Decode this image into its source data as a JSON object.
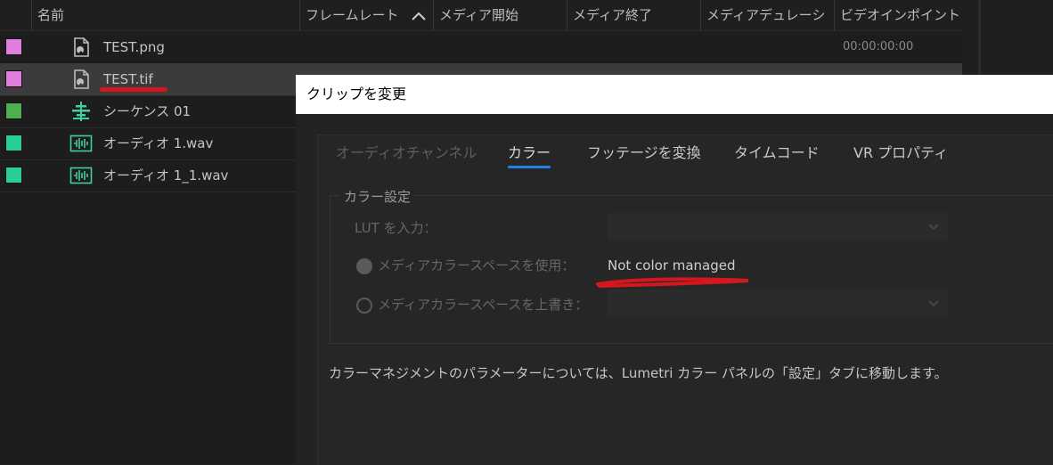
{
  "project_panel": {
    "columns": [
      "名前",
      "フレームレート",
      "メディア開始",
      "メディア終了",
      "メディアデュレーシ",
      "ビデオインポイント"
    ],
    "items": [
      {
        "name": "TEST.png",
        "color": "#e07ee0",
        "icon": "image-file-icon",
        "in_point": "00:00:00:00"
      },
      {
        "name": "TEST.tif",
        "color": "#e07ee0",
        "icon": "image-file-icon",
        "in_point": ""
      },
      {
        "name": "シーケンス 01",
        "color": "#4caf50",
        "icon": "sequence-icon",
        "in_point": ""
      },
      {
        "name": "オーディオ 1.wav",
        "color": "#27cf94",
        "icon": "audio-file-icon",
        "in_point": ""
      },
      {
        "name": "オーディオ 1_1.wav",
        "color": "#27cf94",
        "icon": "audio-file-icon",
        "in_point": ""
      }
    ]
  },
  "dialog": {
    "title": "クリップを変更",
    "tabs": [
      "オーディオチャンネル",
      "カラー",
      "フッテージを変換",
      "タイムコード",
      "VR プロパティ"
    ],
    "active_tab": "カラー",
    "color_settings": {
      "legend": "カラー設定",
      "lut_label": "LUT を入力：",
      "use_media_label": "メディアカラースペースを使用：",
      "use_media_value": "Not color managed",
      "override_label": "メディアカラースペースを上書き："
    },
    "info_text": "カラーマネジメントのパラメーターについては、Lumetri カラー パネルの「設定」タブに移動します。"
  },
  "colors": {
    "accent": "#2680eb",
    "annotation_red": "#d2181e"
  }
}
